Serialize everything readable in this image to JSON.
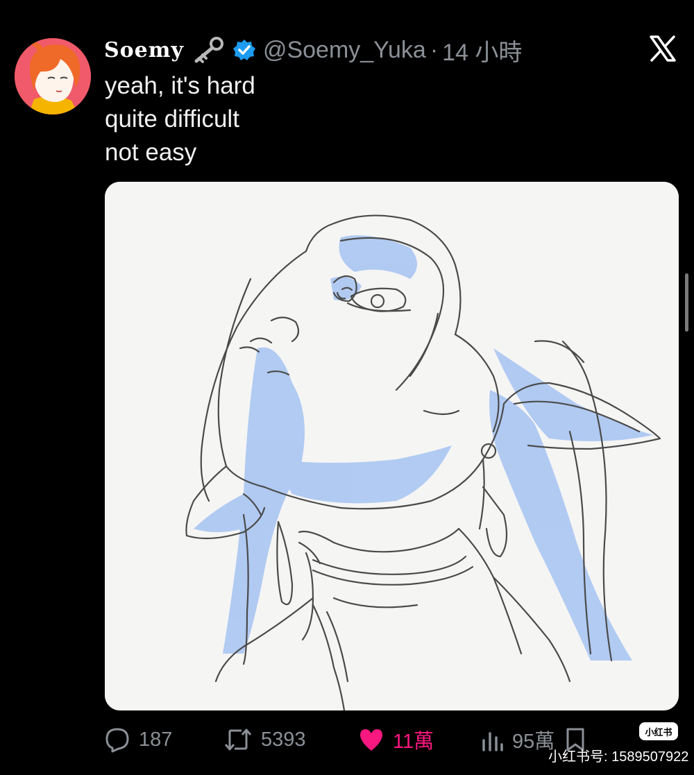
{
  "tweet": {
    "display_name": "Soemy",
    "handle": "@Soemy_Yuka",
    "separator": "·",
    "time": "14 小時",
    "text_lines": [
      "yeah, it's hard",
      "quite difficult",
      "not easy"
    ]
  },
  "actions": {
    "replies": "187",
    "reposts": "5393",
    "likes": "11萬",
    "views": "95萬"
  },
  "watermark": {
    "badge": "小红书",
    "text": "小红书号: 1589507922"
  },
  "colors": {
    "background": "#000000",
    "muted": "#8b9096",
    "like": "#f91880",
    "verified": "#1d9bf0",
    "media_bg": "#f5f5f4",
    "sketch_blue": "#aac6f2"
  },
  "icons": [
    "key-icon",
    "verified-badge-icon",
    "x-logo-icon",
    "reply-icon",
    "repost-icon",
    "heart-icon",
    "views-icon",
    "bookmark-icon"
  ]
}
